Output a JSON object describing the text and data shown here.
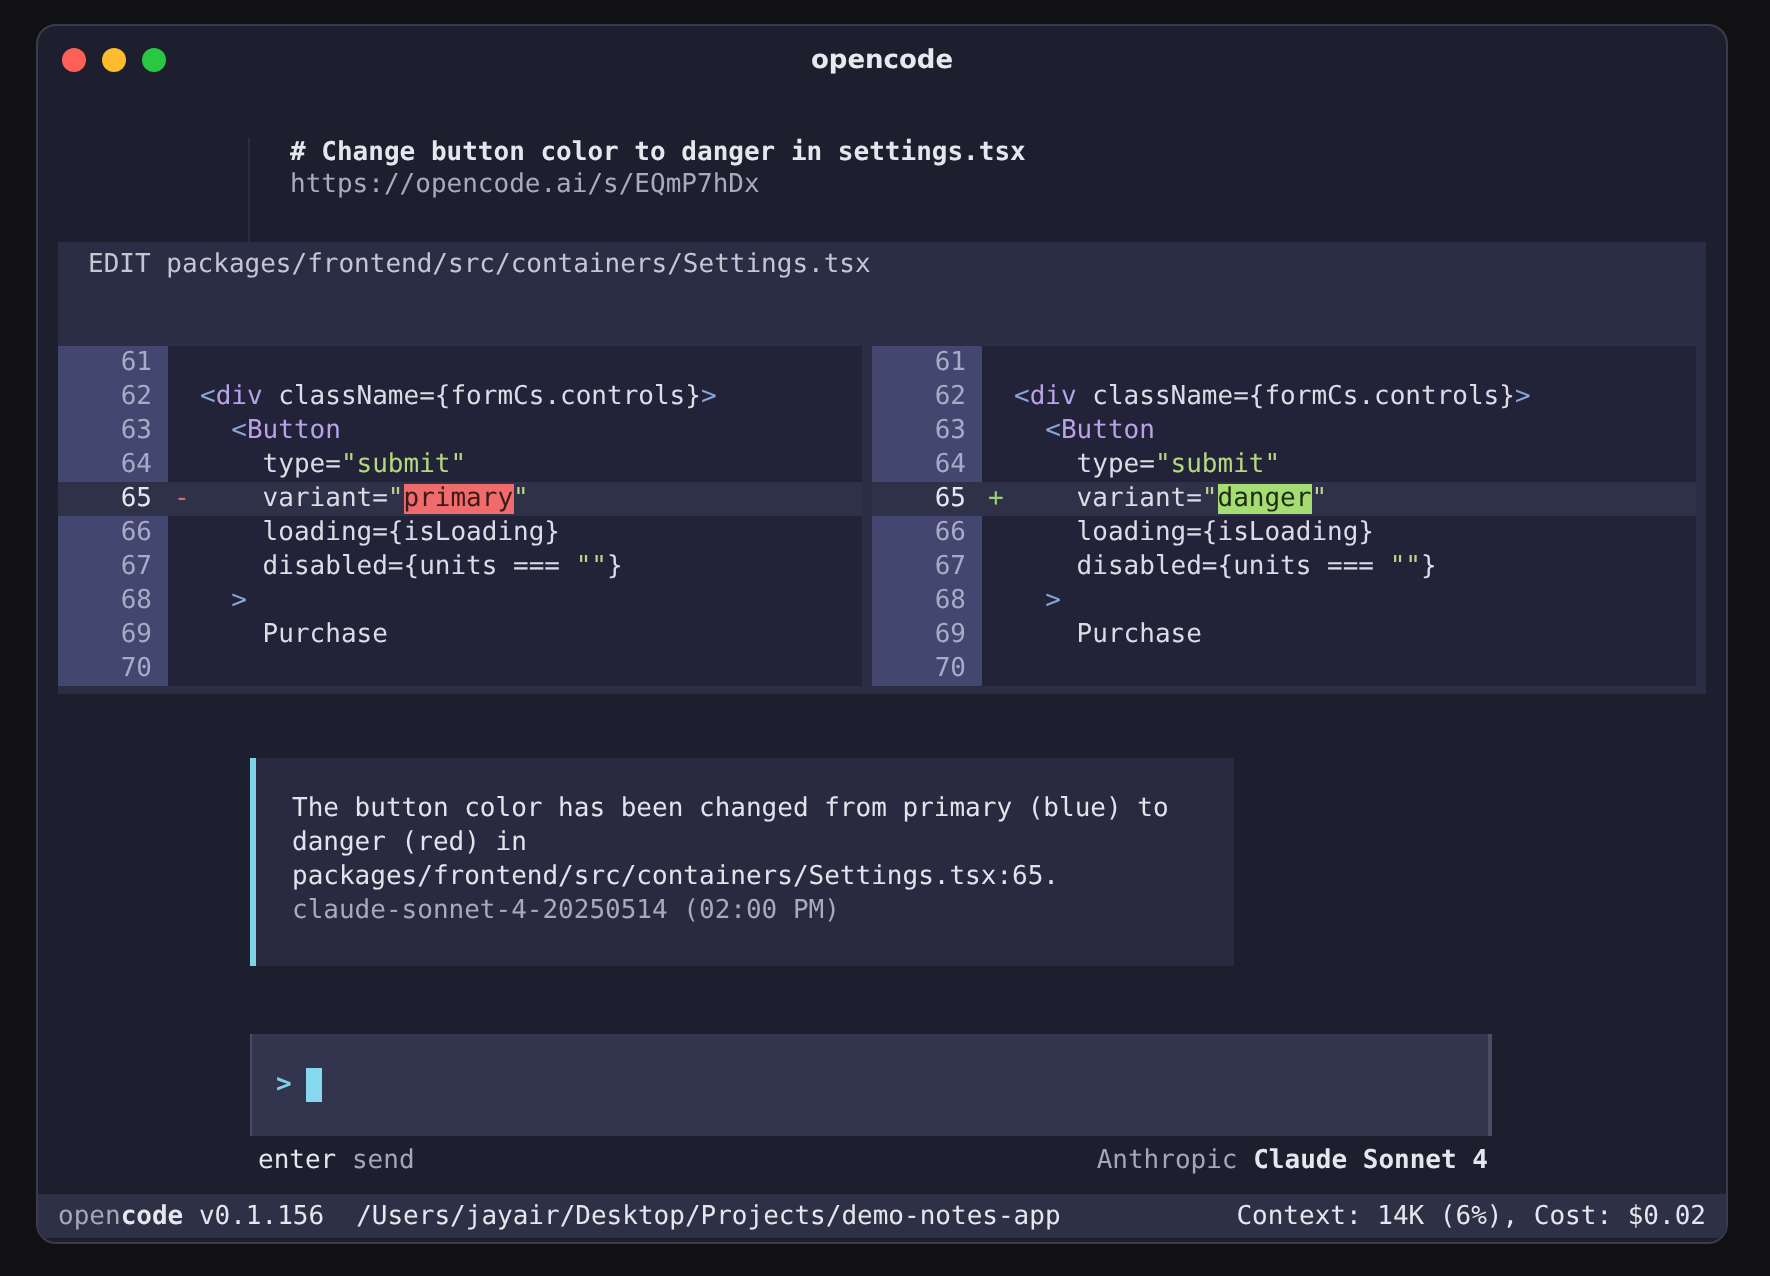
{
  "window": {
    "title": "opencode"
  },
  "session": {
    "title": "# Change button color to danger in settings.tsx",
    "url": "https://opencode.ai/s/EQmP7hDx"
  },
  "edit": {
    "header": "EDIT packages/frontend/src/containers/Settings.tsx",
    "panes": [
      {
        "lines": [
          {
            "number": "61",
            "changed": false
          },
          {
            "number": "62",
            "changed": false,
            "tokens": [
              {
                "kind": "punct",
                "text": "<"
              },
              {
                "kind": "tag",
                "text": "div"
              },
              {
                "kind": "plain",
                "text": " className={formCs.controls}"
              },
              {
                "kind": "punct",
                "text": ">"
              }
            ]
          },
          {
            "number": "63",
            "changed": false,
            "tokens": [
              {
                "kind": "punct",
                "text": "  <"
              },
              {
                "kind": "tag",
                "text": "Button"
              }
            ]
          },
          {
            "number": "64",
            "changed": false,
            "tokens": [
              {
                "kind": "plain",
                "text": "    type="
              },
              {
                "kind": "string",
                "text": "\"submit\""
              }
            ]
          },
          {
            "number": "65",
            "marker": "-",
            "changed": true,
            "tokens": [
              {
                "kind": "plain",
                "text": "    variant="
              },
              {
                "kind": "string",
                "text": "\""
              },
              {
                "kind": "removed",
                "text": "primary"
              },
              {
                "kind": "string",
                "text": "\""
              }
            ]
          },
          {
            "number": "66",
            "changed": false,
            "tokens": [
              {
                "kind": "plain",
                "text": "    loading={isLoading}"
              }
            ]
          },
          {
            "number": "67",
            "changed": false,
            "tokens": [
              {
                "kind": "plain",
                "text": "    disabled={units === "
              },
              {
                "kind": "string",
                "text": "\"\""
              },
              {
                "kind": "plain",
                "text": "}"
              }
            ]
          },
          {
            "number": "68",
            "changed": false,
            "tokens": [
              {
                "kind": "punct",
                "text": "  >"
              }
            ]
          },
          {
            "number": "69",
            "changed": false,
            "tokens": [
              {
                "kind": "plain",
                "text": "    Purchase"
              }
            ]
          },
          {
            "number": "70",
            "changed": false
          }
        ]
      },
      {
        "lines": [
          {
            "number": "61",
            "changed": false
          },
          {
            "number": "62",
            "changed": false,
            "tokens": [
              {
                "kind": "punct",
                "text": "<"
              },
              {
                "kind": "tag",
                "text": "div"
              },
              {
                "kind": "plain",
                "text": " className={formCs.controls}"
              },
              {
                "kind": "punct",
                "text": ">"
              }
            ]
          },
          {
            "number": "63",
            "changed": false,
            "tokens": [
              {
                "kind": "punct",
                "text": "  <"
              },
              {
                "kind": "tag",
                "text": "Button"
              }
            ]
          },
          {
            "number": "64",
            "changed": false,
            "tokens": [
              {
                "kind": "plain",
                "text": "    type="
              },
              {
                "kind": "string",
                "text": "\"submit\""
              }
            ]
          },
          {
            "number": "65",
            "marker": "+",
            "changed": true,
            "tokens": [
              {
                "kind": "plain",
                "text": "    variant="
              },
              {
                "kind": "string",
                "text": "\""
              },
              {
                "kind": "added",
                "text": "danger"
              },
              {
                "kind": "string",
                "text": "\""
              }
            ]
          },
          {
            "number": "66",
            "changed": false,
            "tokens": [
              {
                "kind": "plain",
                "text": "    loading={isLoading}"
              }
            ]
          },
          {
            "number": "67",
            "changed": false,
            "tokens": [
              {
                "kind": "plain",
                "text": "    disabled={units === "
              },
              {
                "kind": "string",
                "text": "\"\""
              },
              {
                "kind": "plain",
                "text": "}"
              }
            ]
          },
          {
            "number": "68",
            "changed": false,
            "tokens": [
              {
                "kind": "punct",
                "text": "  >"
              }
            ]
          },
          {
            "number": "69",
            "changed": false,
            "tokens": [
              {
                "kind": "plain",
                "text": "    Purchase"
              }
            ]
          },
          {
            "number": "70",
            "changed": false
          }
        ]
      }
    ]
  },
  "message": {
    "lines": [
      "The button color has been changed from primary (blue) to",
      "danger (red) in",
      "packages/frontend/src/containers/Settings.tsx:65."
    ],
    "meta": "claude-sonnet-4-20250514 (02:00 PM)"
  },
  "prompt": {
    "symbol": ">"
  },
  "hints": {
    "key": "enter",
    "action": "send",
    "provider": "Anthropic",
    "model": "Claude Sonnet 4"
  },
  "status_bar": {
    "brand_light": "open",
    "brand_bold": "code",
    "version": "v0.1.156",
    "path": "/Users/jayair/Desktop/Projects/demo-notes-app",
    "usage": "Context: 14K (6%), Cost: $0.02"
  }
}
